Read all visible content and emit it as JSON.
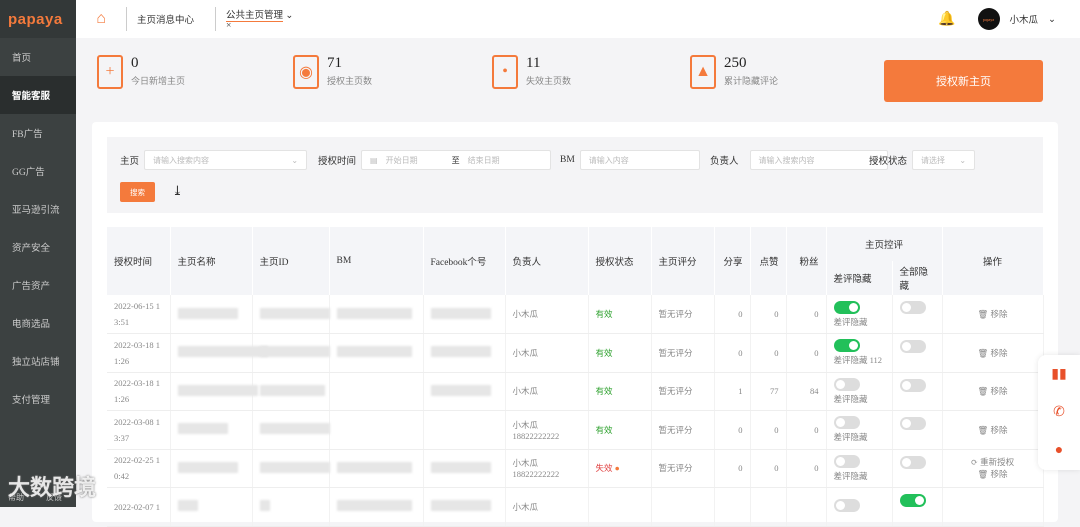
{
  "brand": "papaya",
  "sidebar": {
    "items": [
      "首页",
      "智能客服",
      "FB广告",
      "GG广告",
      "亚马逊引流",
      "资产安全",
      "广告资产",
      "电商选品",
      "独立站店铺",
      "支付管理"
    ],
    "active": 1,
    "bottom": [
      "帮助",
      "反馈"
    ]
  },
  "header": {
    "tabs": [
      "主页消息中心",
      "公共主页管理"
    ],
    "user": "小木瓜",
    "avatar_text": "papaya"
  },
  "stats": [
    {
      "value": "0",
      "label": "今日新增主页"
    },
    {
      "value": "71",
      "label": "授权主页数"
    },
    {
      "value": "11",
      "label": "失效主页数"
    },
    {
      "value": "250",
      "label": "累计隐藏评论"
    }
  ],
  "auth_button": "授权新主页",
  "filter": {
    "page_label": "主页",
    "page_ph": "请输入搜索内容",
    "time_label": "授权时间",
    "start_ph": "开始日期",
    "to": "至",
    "end_ph": "结束日期",
    "bm_label": "BM",
    "bm_ph": "请输入内容",
    "owner_label": "负责人",
    "owner_ph": "请输入搜索内容",
    "status_label": "授权状态",
    "status_ph": "请选择",
    "search": "搜索"
  },
  "table": {
    "headers": [
      "授权时间",
      "主页名称",
      "主页ID",
      "BM",
      "Facebook个号",
      "负责人",
      "授权状态",
      "主页评分",
      "分享",
      "点赞",
      "粉丝",
      "主页控评",
      "差评隐藏",
      "全部隐藏",
      "操作"
    ],
    "rows": [
      {
        "time": "2022-06-15 13:51",
        "owner": "小木瓜",
        "phone": "",
        "status": "有效",
        "score": "暂无评分",
        "share": "0",
        "like": "0",
        "fans": "0",
        "neg": true,
        "neg_label": "差评隐藏",
        "all": false,
        "ops": [
          "移除"
        ]
      },
      {
        "time": "2022-03-18 11:26",
        "owner": "小木瓜",
        "phone": "",
        "status": "有效",
        "score": "暂无评分",
        "share": "0",
        "like": "0",
        "fans": "0",
        "neg": true,
        "neg_label": "差评隐藏 112",
        "all": false,
        "ops": [
          "移除"
        ]
      },
      {
        "time": "2022-03-18 11:26",
        "owner": "小木瓜",
        "phone": "",
        "status": "有效",
        "score": "暂无评分",
        "share": "1",
        "like": "77",
        "fans": "84",
        "neg": false,
        "neg_label": "差评隐藏",
        "all": false,
        "ops": [
          "移除"
        ]
      },
      {
        "time": "2022-03-08 13:37",
        "owner": "小木瓜",
        "phone": "18822222222",
        "status": "有效",
        "score": "暂无评分",
        "share": "0",
        "like": "0",
        "fans": "0",
        "neg": false,
        "neg_label": "差评隐藏",
        "all": false,
        "ops": [
          "移除"
        ]
      },
      {
        "time": "2022-02-25 10:42",
        "owner": "小木瓜",
        "phone": "18822222222",
        "status": "失效",
        "score": "暂无评分",
        "share": "0",
        "like": "0",
        "fans": "0",
        "neg": false,
        "neg_label": "差评隐藏",
        "all": false,
        "ops": [
          "重新授权",
          "移除"
        ]
      },
      {
        "time": "2022-02-07 1",
        "owner": "小木瓜",
        "phone": "",
        "status": "",
        "score": "",
        "share": "",
        "like": "",
        "fans": "",
        "neg": false,
        "neg_label": "",
        "all": true,
        "ops": []
      }
    ]
  },
  "watermark": "大数跨境",
  "colors": {
    "accent": "#f47a3c",
    "sidebar": "#3c4141",
    "ok": "#2ea12e",
    "bad": "#e04444",
    "toggle_on": "#22c05a"
  }
}
